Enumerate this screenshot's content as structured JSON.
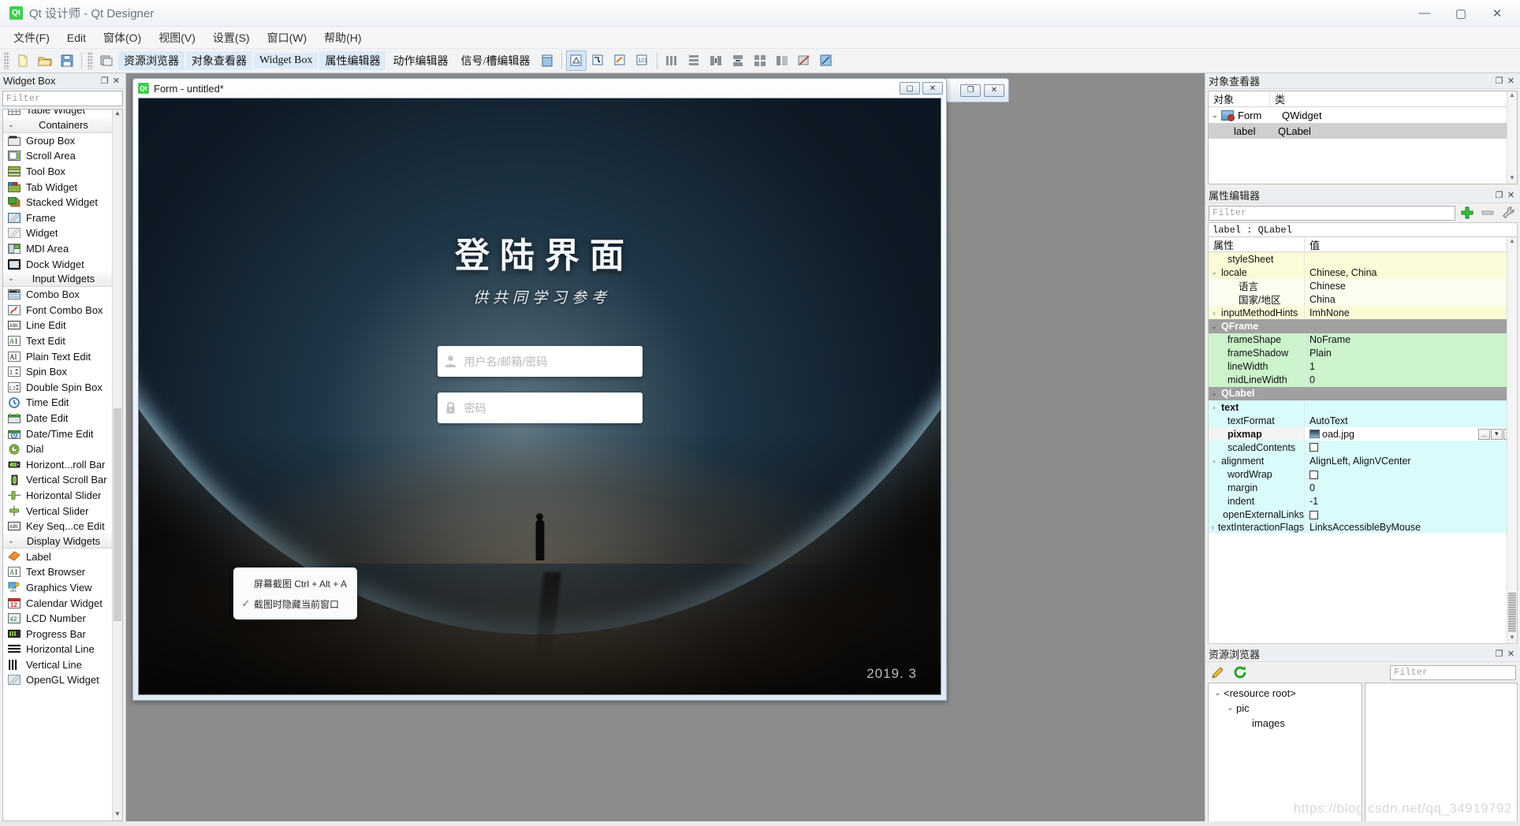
{
  "window": {
    "title": "Qt 设计师 - Qt Designer",
    "logo_text": "Qt",
    "minimize": "—",
    "maximize": "▢",
    "close": "✕"
  },
  "menubar": {
    "items": [
      {
        "label": "文件(F)",
        "name": "menu-file"
      },
      {
        "label": "Edit",
        "name": "menu-edit"
      },
      {
        "label": "窗体(O)",
        "name": "menu-form"
      },
      {
        "label": "视图(V)",
        "name": "menu-view"
      },
      {
        "label": "设置(S)",
        "name": "menu-settings"
      },
      {
        "label": "窗口(W)",
        "name": "menu-window"
      },
      {
        "label": "帮助(H)",
        "name": "menu-help"
      }
    ]
  },
  "toolbar": {
    "dock_tabs": [
      {
        "label": "资源浏览器",
        "highlighted": true
      },
      {
        "label": "对象查看器",
        "highlighted": true
      },
      {
        "label": "Widget Box",
        "highlighted": true
      },
      {
        "label": "属性编辑器",
        "highlighted": true
      },
      {
        "label": "动作编辑器",
        "highlighted": false
      },
      {
        "label": "信号/槽编辑器",
        "highlighted": false
      }
    ]
  },
  "widget_box": {
    "panel_title": "Widget Box",
    "filter_placeholder": "Filter",
    "clipped_top_item": "Table Widget",
    "sections": [
      {
        "name": "Containers",
        "items": [
          "Group Box",
          "Scroll Area",
          "Tool Box",
          "Tab Widget",
          "Stacked Widget",
          "Frame",
          "Widget",
          "MDI Area",
          "Dock Widget"
        ]
      },
      {
        "name": "Input Widgets",
        "items": [
          "Combo Box",
          "Font Combo Box",
          "Line Edit",
          "Text Edit",
          "Plain Text Edit",
          "Spin Box",
          "Double Spin Box",
          "Time Edit",
          "Date Edit",
          "Date/Time Edit",
          "Dial",
          "Horizont...roll Bar",
          "Vertical Scroll Bar",
          "Horizontal Slider",
          "Vertical Slider",
          "Key Seq...ce Edit"
        ]
      },
      {
        "name": "Display Widgets",
        "items": [
          "Label",
          "Text Browser",
          "Graphics View",
          "Calendar Widget",
          "LCD Number",
          "Progress Bar",
          "Horizontal Line",
          "Vertical Line",
          "OpenGL Widget"
        ]
      }
    ]
  },
  "form_window": {
    "title": "Form - untitled*",
    "logo_text": "Qt",
    "maximize_btn": "▢",
    "close_btn": "✕"
  },
  "form_window_back": {
    "restore_btn": "❐",
    "close_btn": "✕"
  },
  "login_design": {
    "title": "登陆界面",
    "subtitle": "供共同学习参考",
    "username_placeholder": "用户名/邮箱/密码",
    "password_placeholder": "密码",
    "username_icon": "user-icon",
    "password_icon": "lock-icon",
    "year_mark": "2019. 3"
  },
  "screenshot_popup": {
    "capture_label": "屏幕截图 Ctrl + Alt + A",
    "hide_window_label": "截图时隐藏当前窗口",
    "check_glyph": "✓"
  },
  "object_inspector": {
    "panel_title": "对象查看器",
    "columns": [
      "对象",
      "类"
    ],
    "rows": [
      {
        "object": "Form",
        "class": "QWidget",
        "level": 0,
        "expanded": true,
        "selected": false
      },
      {
        "object": "label",
        "class": "QLabel",
        "level": 1,
        "expanded": false,
        "selected": true
      }
    ]
  },
  "property_editor": {
    "panel_title": "属性编辑器",
    "filter_placeholder": "Filter",
    "object_line": "label : QLabel",
    "columns": [
      "属性",
      "值"
    ],
    "rows": [
      {
        "key": "styleSheet",
        "value": "",
        "style": "yellow",
        "indent": 1
      },
      {
        "key": "locale",
        "value": "Chinese, China",
        "style": "yellow",
        "indent": 0,
        "chev": "v"
      },
      {
        "key": "语言",
        "value": "Chinese",
        "style": "yellow2",
        "indent": 2
      },
      {
        "key": "国家/地区",
        "value": "China",
        "style": "yellow2",
        "indent": 2
      },
      {
        "key": "inputMethodHints",
        "value": "ImhNone",
        "style": "yellow",
        "indent": 0,
        "chev": ">"
      },
      {
        "key": "QFrame",
        "value": "",
        "style": "group",
        "indent": 0,
        "chev": "v"
      },
      {
        "key": "frameShape",
        "value": "NoFrame",
        "style": "green",
        "indent": 1
      },
      {
        "key": "frameShadow",
        "value": "Plain",
        "style": "green",
        "indent": 1
      },
      {
        "key": "lineWidth",
        "value": "1",
        "style": "green",
        "indent": 1
      },
      {
        "key": "midLineWidth",
        "value": "0",
        "style": "green",
        "indent": 1
      },
      {
        "key": "QLabel",
        "value": "",
        "style": "group",
        "indent": 0,
        "chev": "v"
      },
      {
        "key": "text",
        "value": "",
        "style": "cyan",
        "indent": 0,
        "chev": ">",
        "bold": true
      },
      {
        "key": "textFormat",
        "value": "AutoText",
        "style": "cyan",
        "indent": 1
      },
      {
        "key": "pixmap",
        "value": "oad.jpg",
        "style": "white",
        "indent": 1,
        "bold": true,
        "widget": "pixmap"
      },
      {
        "key": "scaledContents",
        "value": "",
        "style": "cyan",
        "indent": 1,
        "widget": "checkbox"
      },
      {
        "key": "alignment",
        "value": "AlignLeft, AlignVCenter",
        "style": "cyan",
        "indent": 0,
        "chev": ">"
      },
      {
        "key": "wordWrap",
        "value": "",
        "style": "cyan",
        "indent": 1,
        "widget": "checkbox"
      },
      {
        "key": "margin",
        "value": "0",
        "style": "cyan",
        "indent": 1
      },
      {
        "key": "indent",
        "value": "-1",
        "style": "cyan",
        "indent": 1
      },
      {
        "key": "openExternalLinks",
        "value": "",
        "style": "cyan",
        "indent": 1,
        "widget": "checkbox"
      },
      {
        "key": "textInteractionFlags",
        "value": "LinksAccessibleByMouse",
        "style": "cyan",
        "indent": 0,
        "chev": ">"
      }
    ],
    "pixmap_buttons": [
      "...",
      "▾",
      "↶"
    ]
  },
  "resource_browser": {
    "panel_title": "资源浏览器",
    "filter_placeholder": "Filter",
    "edit_icon": "pencil-icon",
    "reload_icon": "refresh-icon",
    "tree": [
      {
        "label": "<resource root>",
        "level": 0,
        "chev": "v"
      },
      {
        "label": "pic",
        "level": 1,
        "chev": "v"
      },
      {
        "label": "images",
        "level": 2,
        "chev": ""
      }
    ]
  },
  "watermark": "https://blog.csdn.net/qq_34919792"
}
